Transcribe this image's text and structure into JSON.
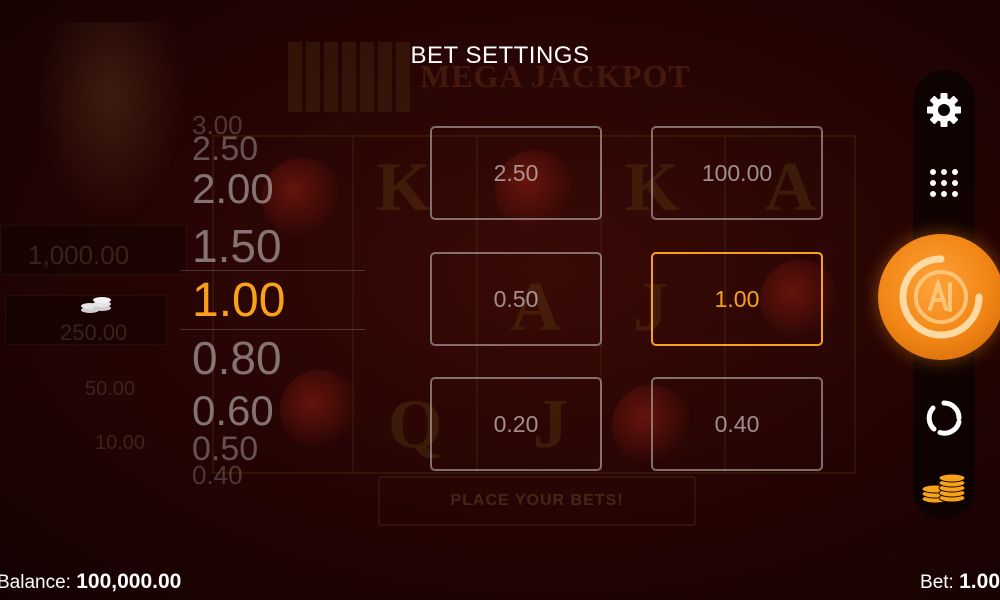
{
  "title": "BET SETTINGS",
  "background": {
    "jackpot_text": "MEGA JACKPOT",
    "place_bets_text": "PLACE YOUR BETS!",
    "left_amounts": [
      "1,000.00",
      "250.00",
      "50.00",
      "10.00"
    ]
  },
  "picker": {
    "values": [
      "3.00",
      "2.50",
      "2.00",
      "1.50",
      "1.00",
      "0.80",
      "0.60",
      "0.50",
      "0.40"
    ],
    "selected": "1.00"
  },
  "options": [
    "2.50",
    "100.00",
    "0.50",
    "1.00",
    "0.20",
    "0.40"
  ],
  "selected_option": "1.00",
  "controls": {
    "settings_icon": "gear-icon",
    "menu_icon": "dots-grid-icon",
    "spin_icon": "spin-icon",
    "autoplay_icon": "autoplay-icon",
    "bet_icon": "coin-stack-icon"
  },
  "footer": {
    "balance_label": "Balance:",
    "balance_value": "100,000.00",
    "bet_label": "Bet:",
    "bet_value": "1.00"
  },
  "colors": {
    "accent": "#f7a21a",
    "spin_orange": "#f08514"
  }
}
